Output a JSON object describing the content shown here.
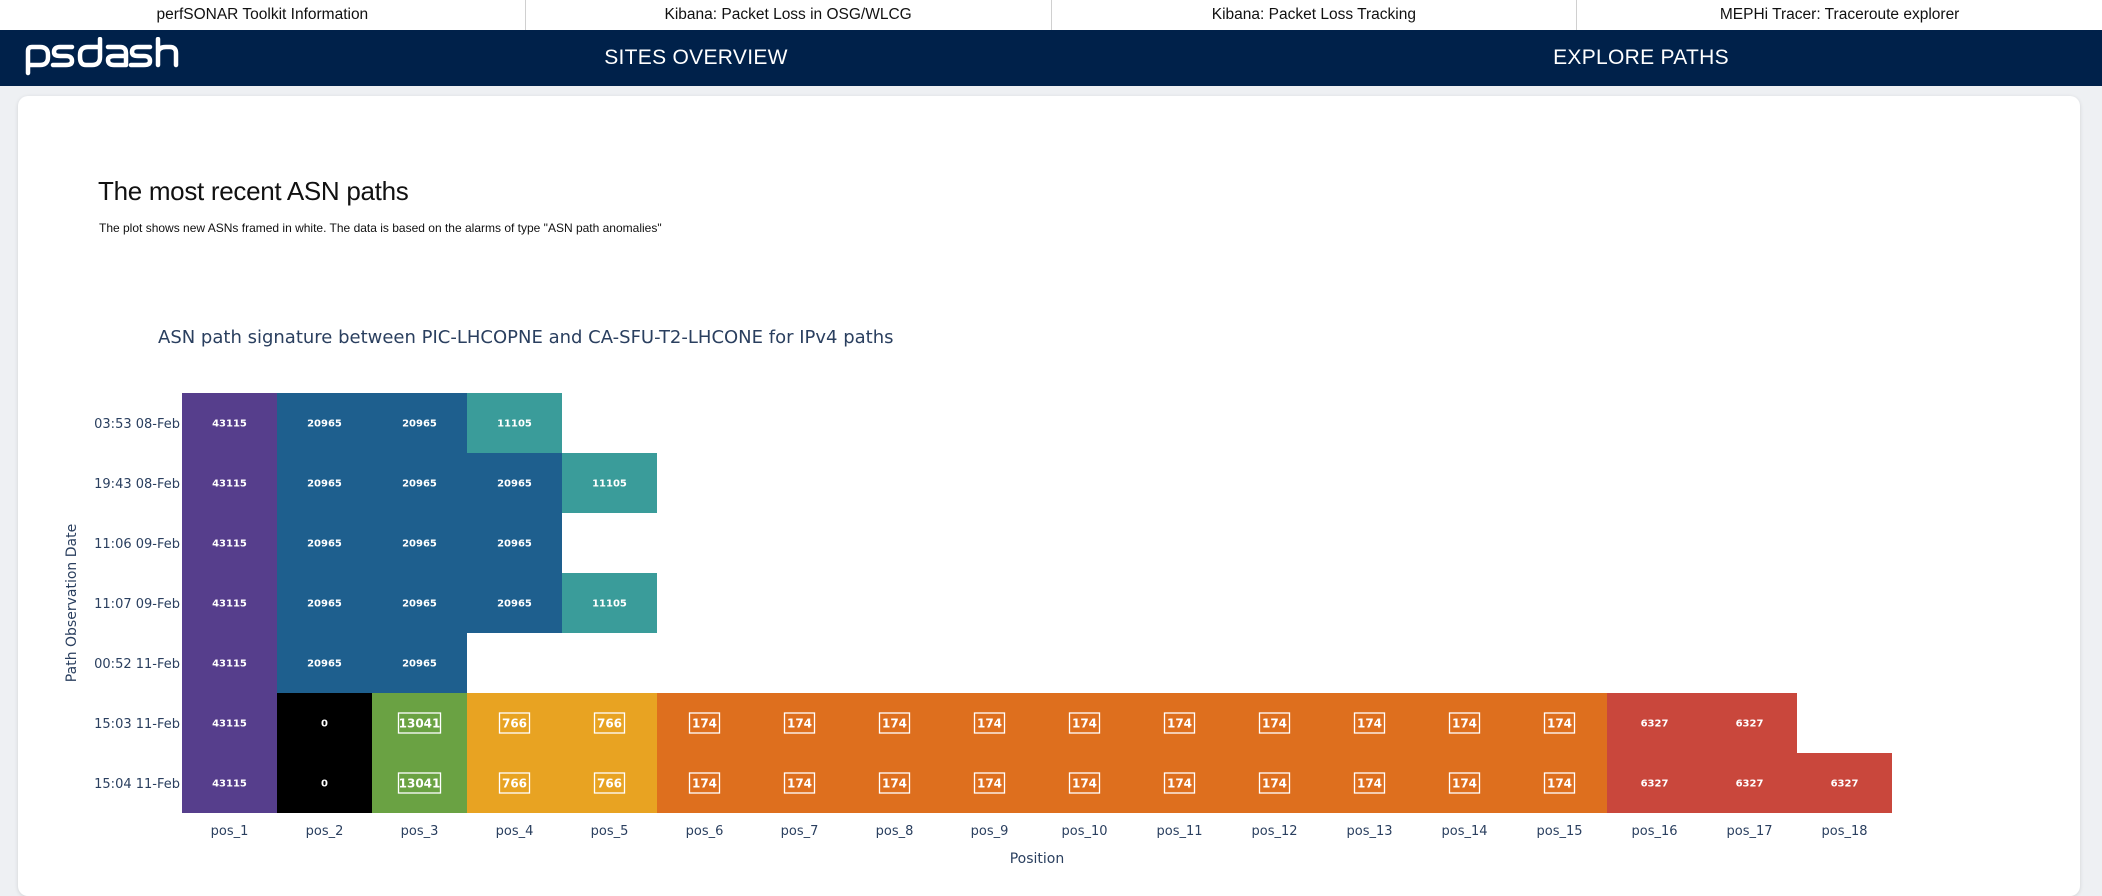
{
  "top_links": [
    "perfSONAR Toolkit Information",
    "Kibana: Packet Loss in OSG/WLCG",
    "Kibana: Packet Loss Tracking",
    "MEPHi Tracer: Traceroute explorer"
  ],
  "navbar": {
    "logo_text": "ps dash",
    "links": [
      "SITES OVERVIEW",
      "EXPLORE PATHS"
    ],
    "background": "#00214a"
  },
  "main": {
    "title": "The most recent ASN paths",
    "subtitle": "The plot shows new ASNs framed in white. The data is based on the alarms of type \"ASN path anomalies\""
  },
  "chart_data": {
    "type": "heatmap",
    "title": "ASN path signature between PIC-LHCOPNE and CA-SFU-T2-LHCONE for IPv4 paths",
    "xlabel": "Position",
    "ylabel": "Path Observation Date",
    "x": [
      "pos_1",
      "pos_2",
      "pos_3",
      "pos_4",
      "pos_5",
      "pos_6",
      "pos_7",
      "pos_8",
      "pos_9",
      "pos_10",
      "pos_11",
      "pos_12",
      "pos_13",
      "pos_14",
      "pos_15",
      "pos_16",
      "pos_17",
      "pos_18"
    ],
    "y": [
      "03:53 08-Feb",
      "19:43 08-Feb",
      "11:06 09-Feb",
      "11:07 09-Feb",
      "00:52 11-Feb",
      "15:03 11-Feb",
      "15:04 11-Feb"
    ],
    "asn_colors": {
      "43115": "#563e8c",
      "20965": "#1e5f8e",
      "11105": "#3a9c9a",
      "0": "#000000",
      "13041": "#6aa243",
      "766": "#e8a322",
      "174": "#de6f1e",
      "6327": "#c9473c"
    },
    "new_asns": [
      "13041",
      "766",
      "174"
    ],
    "rows": [
      [
        "43115",
        "20965",
        "20965",
        "11105"
      ],
      [
        "43115",
        "20965",
        "20965",
        "20965",
        "11105"
      ],
      [
        "43115",
        "20965",
        "20965",
        "20965"
      ],
      [
        "43115",
        "20965",
        "20965",
        "20965",
        "11105"
      ],
      [
        "43115",
        "20965",
        "20965"
      ],
      [
        "43115",
        "0",
        "13041",
        "766",
        "766",
        "174",
        "174",
        "174",
        "174",
        "174",
        "174",
        "174",
        "174",
        "174",
        "174",
        "6327",
        "6327"
      ],
      [
        "43115",
        "0",
        "13041",
        "766",
        "766",
        "174",
        "174",
        "174",
        "174",
        "174",
        "174",
        "174",
        "174",
        "174",
        "174",
        "6327",
        "6327",
        "6327"
      ]
    ]
  }
}
